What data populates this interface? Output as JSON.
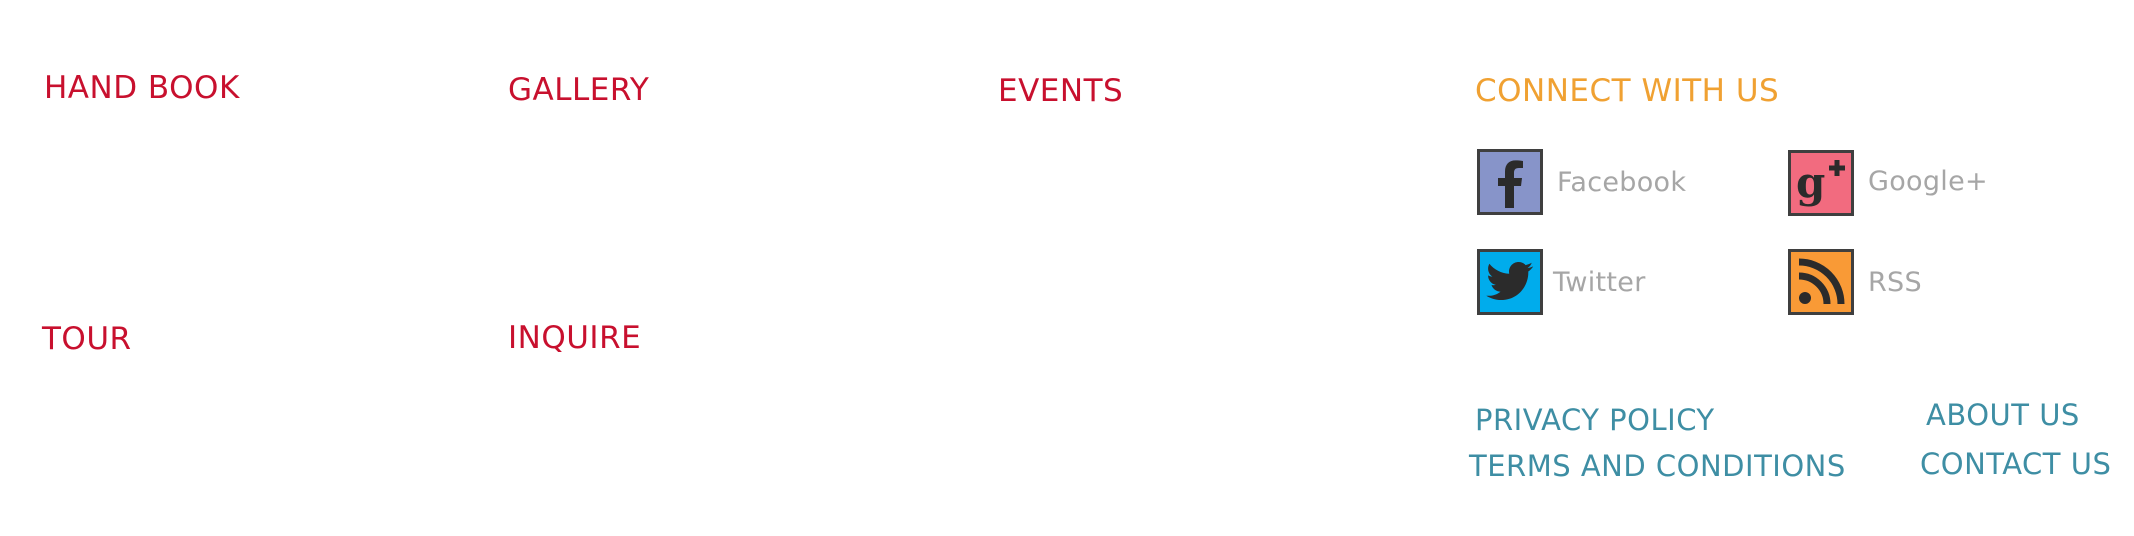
{
  "nav": {
    "handbook": "HAND BOOK",
    "gallery": "GALLERY",
    "events": "EVENTS",
    "tour": "TOUR",
    "inquire": "INQUIRE"
  },
  "connect": {
    "title": "CONNECT WITH US",
    "social": [
      {
        "label": "Facebook",
        "icon": "facebook-icon",
        "color": "#8794c9"
      },
      {
        "label": "Google+",
        "icon": "google-plus-icon",
        "color": "#f26b7f"
      },
      {
        "label": "Twitter",
        "icon": "twitter-icon",
        "color": "#00acec"
      },
      {
        "label": "RSS",
        "icon": "rss-icon",
        "color": "#f99a36"
      }
    ]
  },
  "footer": {
    "privacy": "PRIVACY POLICY",
    "terms": "TERMS AND CONDITIONS",
    "about": "ABOUT US",
    "contact": "CONTACT US"
  },
  "colors": {
    "nav": "#c8102e",
    "connect_title": "#f0a132",
    "social_label": "#a6a6a6",
    "footer_link": "#3e8ea4"
  }
}
